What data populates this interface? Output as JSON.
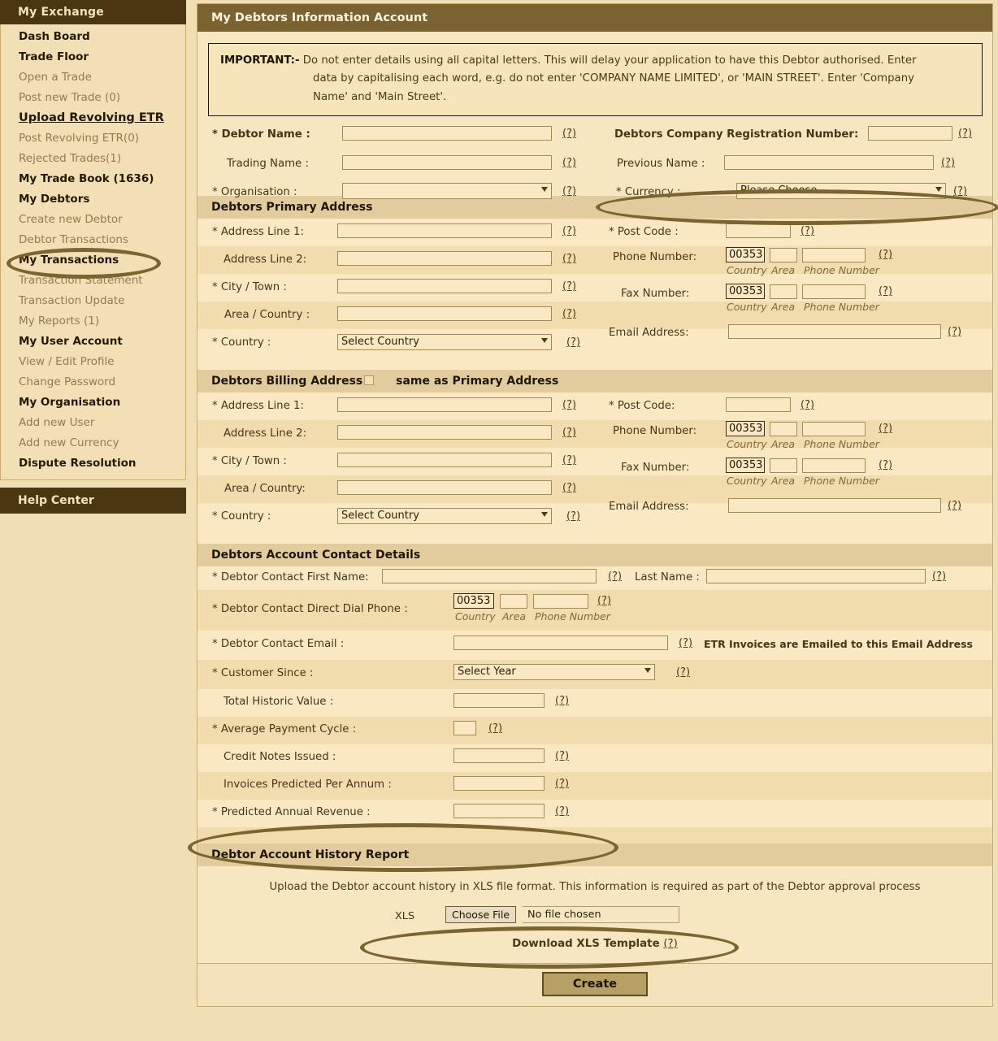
{
  "sidebar": {
    "header": "My Exchange",
    "help": "Help Center",
    "items": [
      {
        "label": "Dash Board",
        "type": "head"
      },
      {
        "label": "Trade Floor",
        "type": "head"
      },
      {
        "label": "Open a Trade",
        "type": "link"
      },
      {
        "label": "Post new Trade (0)",
        "type": "link"
      },
      {
        "label": "Upload Revolving ETR",
        "type": "active"
      },
      {
        "label": "Post Revolving ETR(0)",
        "type": "link"
      },
      {
        "label": "Rejected Trades(1)",
        "type": "link"
      },
      {
        "label": "My Trade Book (1636)",
        "type": "head"
      },
      {
        "label": "My Debtors",
        "type": "head"
      },
      {
        "label": "Create new Debtor",
        "type": "link"
      },
      {
        "label": "Debtor Transactions",
        "type": "link"
      },
      {
        "label": "My Transactions",
        "type": "head"
      },
      {
        "label": "Transaction Statement",
        "type": "link"
      },
      {
        "label": "Transaction Update",
        "type": "link"
      },
      {
        "label": "My Reports (1)",
        "type": "link"
      },
      {
        "label": "My User Account",
        "type": "head"
      },
      {
        "label": "View / Edit Profile",
        "type": "link"
      },
      {
        "label": "Change Password",
        "type": "link"
      },
      {
        "label": "My Organisation",
        "type": "head"
      },
      {
        "label": "Add new User",
        "type": "link"
      },
      {
        "label": "Add new Currency",
        "type": "link"
      },
      {
        "label": "Dispute Resolution",
        "type": "head"
      }
    ]
  },
  "main": {
    "title": "My Debtors Information Account",
    "notice": {
      "label": "IMPORTANT:-",
      "line1": " Do not enter details using all capital letters. This will delay your application to have this Debtor authorised. Enter",
      "line2": "data by capitalising each word, e.g. do not enter 'COMPANY NAME LIMITED', or 'MAIN STREET'. Enter 'Company",
      "line3": "Name' and 'Main Street'."
    },
    "hint": "(?)",
    "top": {
      "debtor_name": "* Debtor Name :",
      "trading_name": "Trading Name :",
      "organisation": "* Organisation :",
      "organisation_value": "",
      "company_reg": "Debtors Company Registration Number:",
      "previous_name": "Previous Name :",
      "currency": "* Currency :",
      "currency_value": "Please Choose"
    },
    "primary": {
      "heading": "Debtors Primary Address",
      "address1": "* Address Line 1:",
      "address2": "Address Line 2:",
      "city": "* City / Town :",
      "area": "Area / Country :",
      "country": "* Country :",
      "country_value": "Select Country",
      "postcode": "* Post Code :",
      "phone": "Phone Number:",
      "fax": "Fax Number:",
      "email": "Email Address:",
      "dial_code": "00353",
      "sub_country": "Country",
      "sub_area": "Area",
      "sub_phone": "Phone Number"
    },
    "billing": {
      "heading": "Debtors Billing Address",
      "same_as": "same as Primary Address",
      "address1": "* Address Line 1:",
      "address2": "Address Line 2:",
      "city": "* City / Town :",
      "area": "Area / Country:",
      "country": "* Country :",
      "country_value": "Select Country",
      "postcode": "* Post Code:",
      "phone": "Phone Number:",
      "fax": "Fax Number:",
      "email": "Email Address:",
      "dial_code": "00353",
      "sub_country": "Country",
      "sub_area": "Area",
      "sub_phone": "Phone Number"
    },
    "contact": {
      "heading": "Debtors Account Contact Details",
      "first_name": "* Debtor Contact First Name:",
      "last_name": "Last Name :",
      "direct_dial": "* Debtor Contact Direct Dial Phone :",
      "dial_code": "00353",
      "sub_country": "Country",
      "sub_area": "Area",
      "sub_phone": "Phone Number",
      "email": "* Debtor Contact Email :",
      "email_note": "ETR Invoices are Emailed to this Email Address",
      "customer_since": "* Customer Since :",
      "customer_since_value": "Select Year",
      "historic_value": "Total Historic Value :",
      "payment_cycle": "* Average Payment Cycle :",
      "credit_notes": "Credit Notes Issued :",
      "invoices_predicted": "Invoices Predicted Per Annum :",
      "annual_revenue": "* Predicted Annual Revenue :"
    },
    "history": {
      "heading": "Debtor Account History Report",
      "text": "Upload the Debtor account history in XLS file format. This information is required as part of the Debtor approval process",
      "xls_label": "XLS",
      "choose_file": "Choose File",
      "no_file": "No file chosen",
      "download": "Download XLS Template",
      "download_hint": "(?)"
    },
    "create_button": "Create"
  },
  "colors": {
    "header_brown": "#4a3711",
    "panel_title": "#7a6331",
    "page_bg": "#f0deb4",
    "annotation": "#7a6531"
  }
}
